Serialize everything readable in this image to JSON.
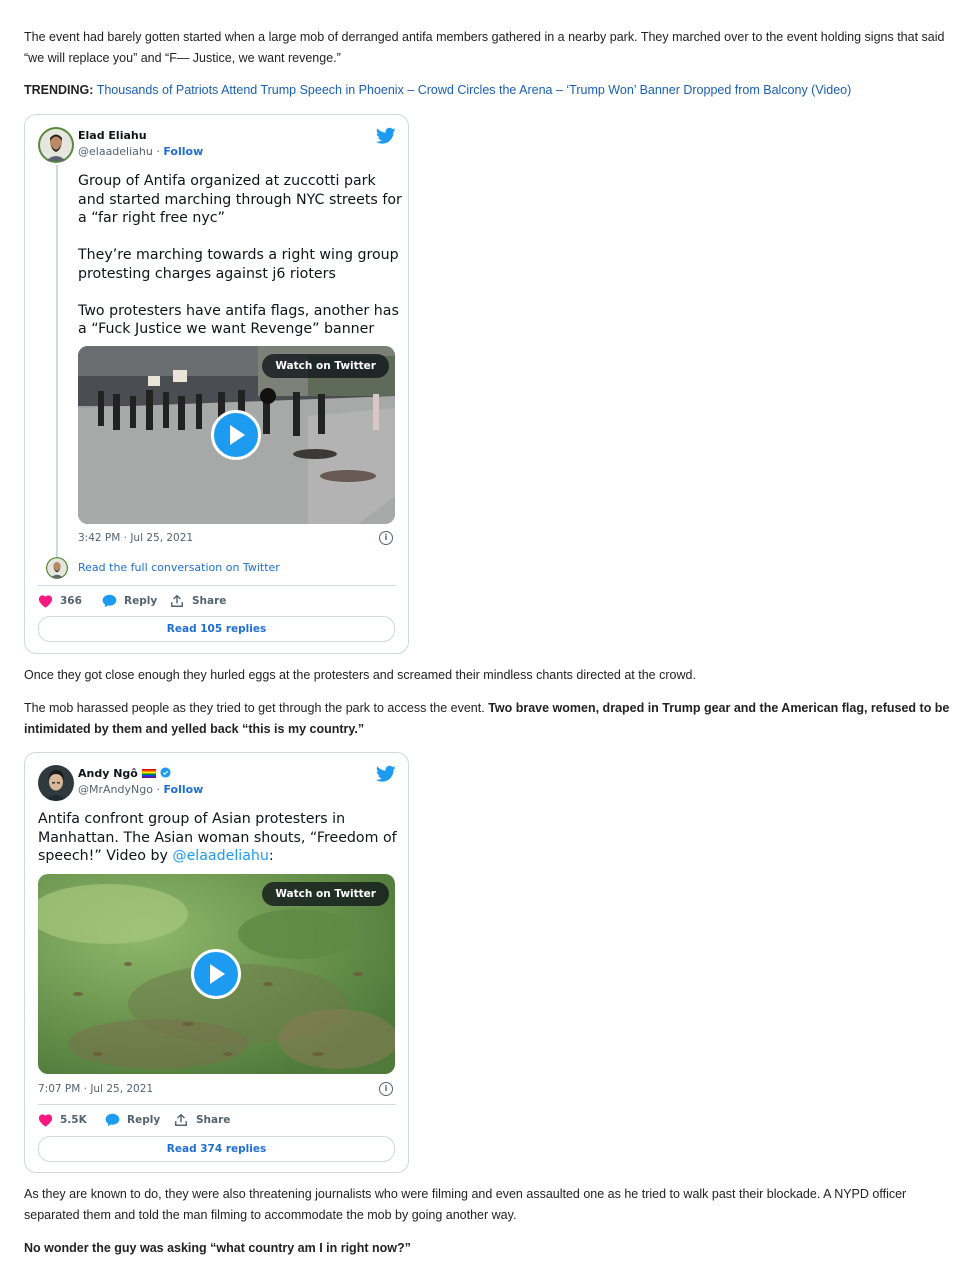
{
  "article": {
    "p1": "The event had barely gotten started when a large mob of derranged antifa members gathered in a nearby park. They marched over to the event holding signs that said “we will replace you” and “F— Justice, we want revenge.”",
    "trending_label": "TRENDING:",
    "trending_link": "Thousands of Patriots Attend Trump Speech in Phoenix – Crowd Circles the Arena – ‘Trump Won’ Banner Dropped from Balcony (Video)",
    "p2": "Once they got close enough they hurled eggs at the protesters and screamed their mindless chants directed at the crowd.",
    "p3_normal": "The mob harassed people as they tried to get through the park to access the event. ",
    "p3_bold": "Two brave women, draped in Trump gear and the American flag, refused to be intimidated by them and yelled back “this is my country.”",
    "p4": "As they are known to do, they were also threatening journalists who were filming and even assaulted one as he tried to walk past their blockade. A NYPD officer separated them and told the man filming to accommodate the mob by going another way.",
    "p5": "No wonder the guy was asking “what country am I in right now?”"
  },
  "tweet1": {
    "name": "Elad Eliahu",
    "handle": "@elaadeliahu",
    "separator": " · ",
    "follow": "Follow",
    "text": "Group of Antifa organized at zuccotti park and started marching through NYC streets for a “far right free nyc”\n\nThey’re marching towards a right wing group protesting charges against j6 rioters\n\nTwo protesters have antifa flags, another has a “Fuck Justice we want Revenge” banner",
    "watch": "Watch on Twitter",
    "time": "3:42 PM · Jul 25, 2021",
    "conversation": "Read the full conversation on Twitter",
    "likes": "366",
    "reply": "Reply",
    "share": "Share",
    "read_replies": "Read 105 replies"
  },
  "tweet2": {
    "name": "Andy Ngô",
    "name_emoji": "🏳️‍🌈",
    "handle": "@MrAndyNgo",
    "separator": " · ",
    "follow": "Follow",
    "text_pre": "Antifa confront group of Asian protesters in Manhattan. The Asian woman shouts, “Freedom of speech!” Video by ",
    "mention": "@elaadeliahu",
    "text_post": ":",
    "watch": "Watch on Twitter",
    "time": "7:07 PM · Jul 25, 2021",
    "likes": "5.5K",
    "reply": "Reply",
    "share": "Share",
    "read_replies": "Read 374 replies"
  },
  "icons": {
    "twitter_bird": "twitter-bird-icon",
    "heart": "heart-icon",
    "reply": "reply-bubble-icon",
    "share": "share-icon",
    "info": "info-icon",
    "play": "play-icon",
    "verified": "verified-badge-icon"
  },
  "colors": {
    "twitter_blue": "#1d9bf0",
    "link_blue": "#1a5fb4",
    "heart_pink": "#f91880",
    "text_dark": "#0f1419",
    "text_gray": "#536471",
    "border": "#cfd9de"
  }
}
